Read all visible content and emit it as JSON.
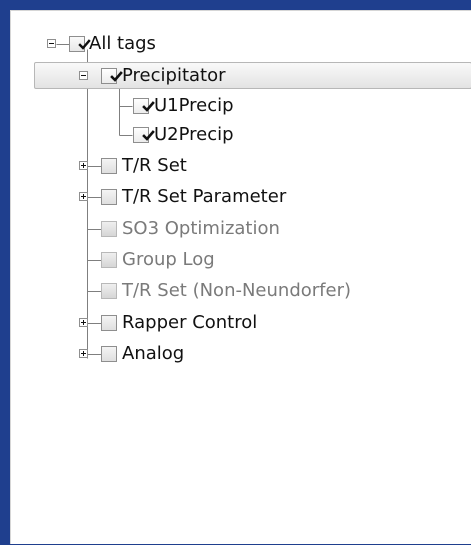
{
  "tree": {
    "items": [
      {
        "label": "All tags",
        "expanded": true,
        "checked": "mixed",
        "disabled": false,
        "selected": false
      },
      {
        "label": "Precipitator",
        "expanded": true,
        "checked": "checked",
        "disabled": false,
        "selected": true
      },
      {
        "label": "U1Precip",
        "checked": "checked",
        "disabled": false,
        "selected": false
      },
      {
        "label": "U2Precip",
        "checked": "checked",
        "disabled": false,
        "selected": false
      },
      {
        "label": "T/R Set",
        "expanded": false,
        "checked": "unchecked",
        "disabled": false,
        "selected": false
      },
      {
        "label": "T/R Set Parameter",
        "expanded": false,
        "checked": "unchecked",
        "disabled": false,
        "selected": false
      },
      {
        "label": "SO3 Optimization",
        "checked": "unchecked",
        "disabled": true,
        "selected": false
      },
      {
        "label": "Group Log",
        "checked": "unchecked",
        "disabled": true,
        "selected": false
      },
      {
        "label": "T/R Set (Non-Neundorfer)",
        "checked": "unchecked",
        "disabled": true,
        "selected": false
      },
      {
        "label": "Rapper Control",
        "expanded": false,
        "checked": "unchecked",
        "disabled": false,
        "selected": false
      },
      {
        "label": "Analog",
        "expanded": false,
        "checked": "unchecked",
        "disabled": false,
        "selected": false
      }
    ]
  },
  "colors": {
    "background": "#1f3f8e",
    "panel": "#ffffff",
    "text": "#111111",
    "disabled_text": "#7a7a7a",
    "lines": "#7f7f7f"
  }
}
